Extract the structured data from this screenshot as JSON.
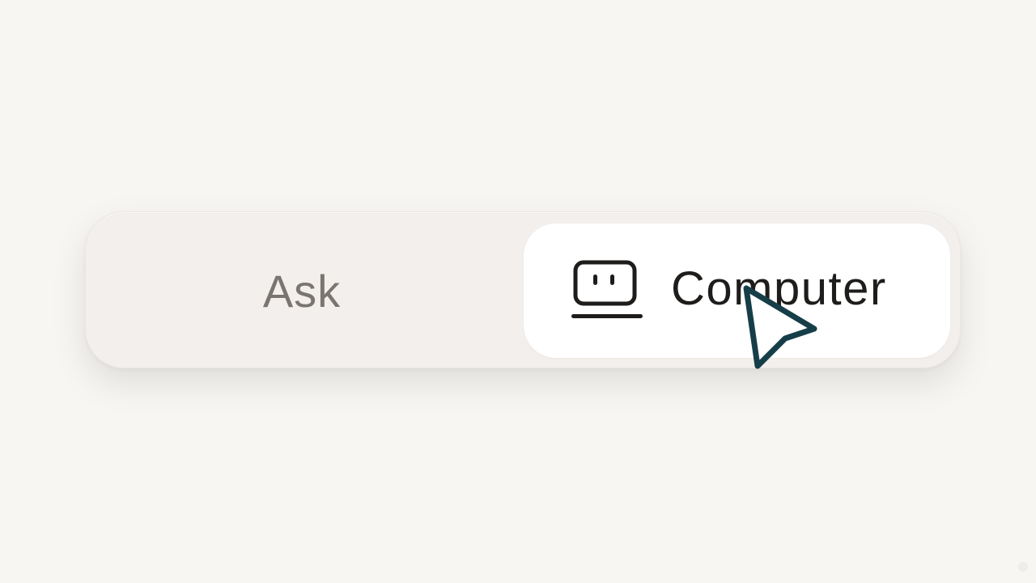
{
  "mode_toggle": {
    "options": [
      {
        "label": "Ask",
        "selected": false
      },
      {
        "label": "Computer",
        "selected": true,
        "icon": "computer-icon"
      }
    ]
  },
  "colors": {
    "background": "#f8f6f3",
    "toggle_track": "#f3efec",
    "selected_pill": "#ffffff",
    "inactive_text": "#7a7571",
    "active_text": "#1f1d1b",
    "cursor_outline": "#163e48"
  },
  "pointer": {
    "icon": "mouse-pointer-icon"
  }
}
